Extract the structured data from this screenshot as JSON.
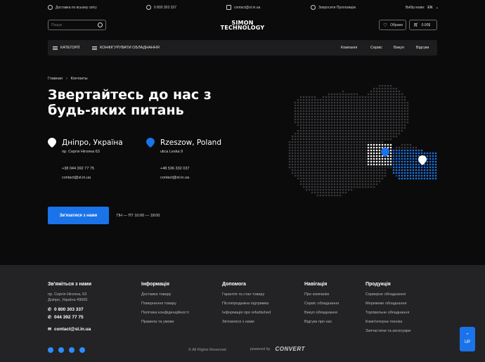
{
  "topbar": {
    "delivery": "Доставка по всьому світу",
    "phone": "0 800 303 337",
    "email": "contact@st.in.ua",
    "callback": "Запросити Пропозицію",
    "lang_label": "Вибір мови:",
    "lang_value": "EN"
  },
  "search": {
    "placeholder": "Пошук"
  },
  "logo": {
    "line1": "SIMON",
    "line2": "TECHNOLOGY"
  },
  "header": {
    "favorites": "Обране",
    "cart": "0.00$"
  },
  "nav": {
    "categories": "КАТЕГОРІЇ",
    "configure": "КОНФІГУРУВАТИ ОБЛАДНАННЯ",
    "links": [
      "Компанія",
      "Сервіс",
      "Викуп",
      "Відгуки"
    ]
  },
  "breadcrumb": {
    "home": "Главная",
    "separator": "›",
    "current": "Контакты"
  },
  "page_title": "Звертайтесь до нас з будь-яких питань",
  "locations": [
    {
      "city": "Дніпро, Україна",
      "address": "пр. Сергія Нігояна 63",
      "phone": "+38 044 392 77 75",
      "email": "contact@st.in.ua",
      "pin_color": "#ffffff"
    },
    {
      "city": "Rzeszow, Poland",
      "address": "ulica Leska 9",
      "phone": "+48 536 332 037",
      "email": "contact@st.in.ua",
      "pin_color": "#1a73e8"
    }
  ],
  "cta": {
    "label": "Зв'язатися з нами",
    "hours": "ПН — ПТ 10:00 — 18:00"
  },
  "footer": {
    "contact": {
      "heading": "Зв'яжіться з нами",
      "address1": "пр. Сергія Нігояна, 63",
      "address2": "Дніпро, Україна 49000",
      "phone1": "0 800 303 337",
      "phone2": "044 392 77 75",
      "email": "contact@st.in.ua"
    },
    "columns": [
      {
        "heading": "Інформація",
        "links": [
          "Доставка товару",
          "Повернення товару",
          "Політика конфіденційності",
          "Правила та умови"
        ]
      },
      {
        "heading": "Допомога",
        "links": [
          "Гарантія та стан товару",
          "Післяпродажна підтримка",
          "Інформація про refurbished",
          "Зв'язатися з нами"
        ]
      },
      {
        "heading": "Навігація",
        "links": [
          "Про компанію",
          "Сервіс обладнання",
          "Викуп обладнання",
          "Відгуки про нас"
        ]
      },
      {
        "heading": "Продукція",
        "links": [
          "Серверне обладнання",
          "Мережеве обладнання",
          "Торгівельне обладнання",
          "Комп'ютерна техніка",
          "Запчастини та аксесуари"
        ]
      }
    ],
    "copyright": "© All Rights Reserved",
    "powered_label": "powered by",
    "powered_brand": "CONVERT"
  },
  "up_button": "UP",
  "colors": {
    "accent": "#1a73e8",
    "background": "#0b0b0c",
    "footer": "#232325"
  }
}
